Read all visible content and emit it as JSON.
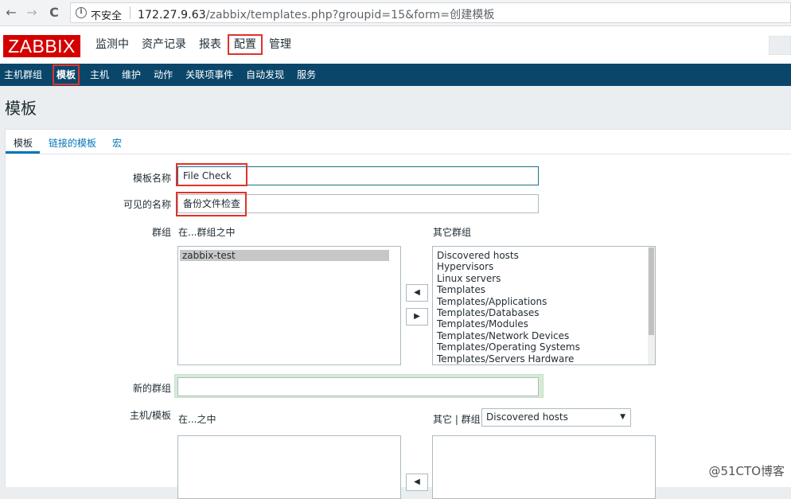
{
  "browser": {
    "back": "←",
    "forward": "→",
    "reload": "C",
    "insecure_label": "不安全",
    "url_host": "172.27.9.63",
    "url_path": "/zabbix/templates.php?groupid=15&form=创建模板"
  },
  "header": {
    "logo": "ZABBIX",
    "menu": [
      "监测中",
      "资产记录",
      "报表",
      "配置",
      "管理"
    ]
  },
  "subnav": {
    "items": [
      "主机群组",
      "模板",
      "主机",
      "维护",
      "动作",
      "关联项事件",
      "自动发现",
      "服务"
    ]
  },
  "page": {
    "title": "模板"
  },
  "tabs": [
    "模板",
    "链接的模板",
    "宏"
  ],
  "form": {
    "template_name_label": "模板名称",
    "template_name_value": "File Check",
    "visible_name_label": "可见的名称",
    "visible_name_value": "备份文件检查",
    "groups_label": "群组",
    "in_groups_header": "在...群组之中",
    "other_groups_header": "其它群组",
    "in_groups": [
      "zabbix-test"
    ],
    "other_groups": [
      "Discovered hosts",
      "Hypervisors",
      "Linux servers",
      "Templates",
      "Templates/Applications",
      "Templates/Databases",
      "Templates/Modules",
      "Templates/Network Devices",
      "Templates/Operating Systems",
      "Templates/Servers Hardware"
    ],
    "move_left": "◀",
    "move_right": "▶",
    "new_group_label": "新的群组",
    "new_group_value": "",
    "hosts_templates_label": "主机/模板",
    "in_hosts_header": "在...之中",
    "other_hosts_header": "其它 | 群组",
    "other_hosts_group_selected": "Discovered hosts"
  },
  "watermark": "@51CTO博客"
}
